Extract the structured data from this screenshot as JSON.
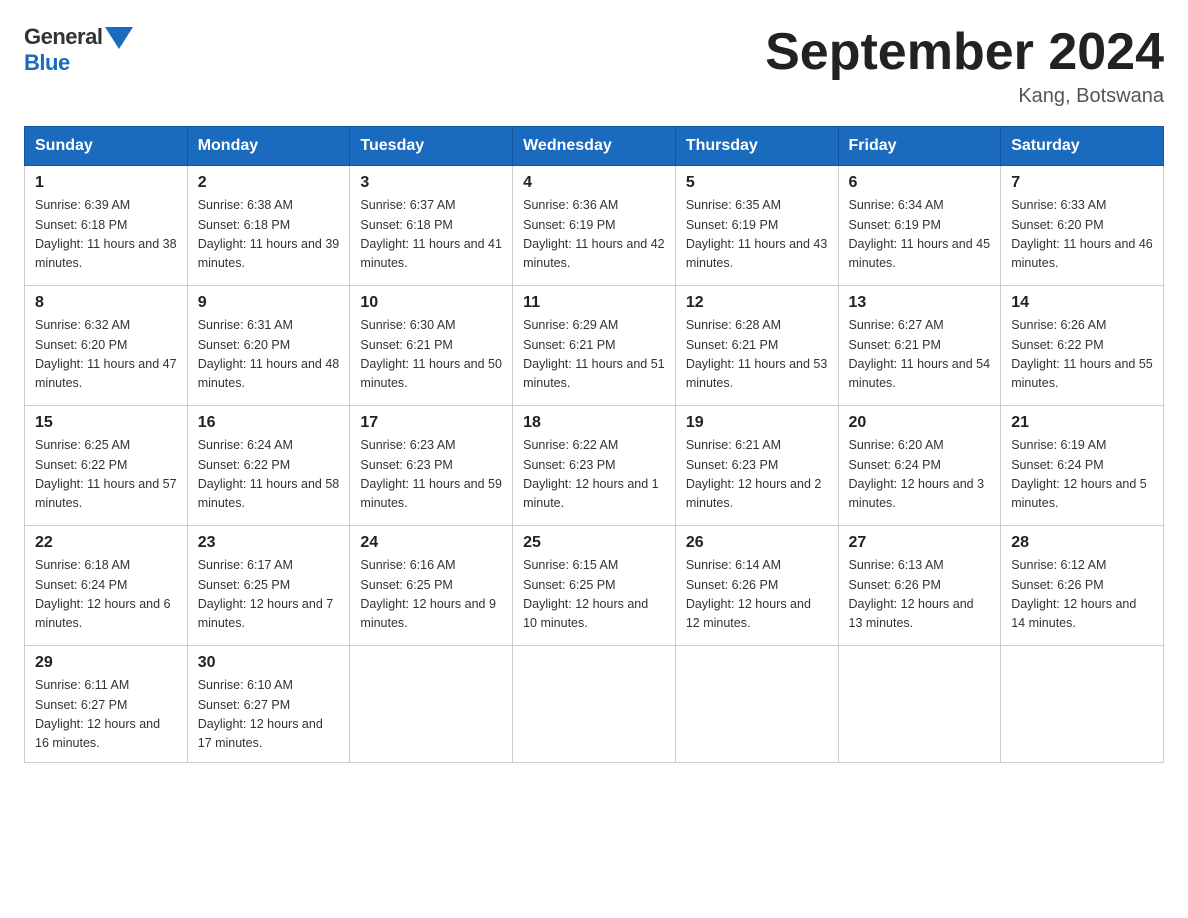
{
  "logo": {
    "general": "General",
    "blue": "Blue"
  },
  "title": "September 2024",
  "subtitle": "Kang, Botswana",
  "header_days": [
    "Sunday",
    "Monday",
    "Tuesday",
    "Wednesday",
    "Thursday",
    "Friday",
    "Saturday"
  ],
  "weeks": [
    [
      {
        "day": "1",
        "sunrise": "6:39 AM",
        "sunset": "6:18 PM",
        "daylight": "11 hours and 38 minutes."
      },
      {
        "day": "2",
        "sunrise": "6:38 AM",
        "sunset": "6:18 PM",
        "daylight": "11 hours and 39 minutes."
      },
      {
        "day": "3",
        "sunrise": "6:37 AM",
        "sunset": "6:18 PM",
        "daylight": "11 hours and 41 minutes."
      },
      {
        "day": "4",
        "sunrise": "6:36 AM",
        "sunset": "6:19 PM",
        "daylight": "11 hours and 42 minutes."
      },
      {
        "day": "5",
        "sunrise": "6:35 AM",
        "sunset": "6:19 PM",
        "daylight": "11 hours and 43 minutes."
      },
      {
        "day": "6",
        "sunrise": "6:34 AM",
        "sunset": "6:19 PM",
        "daylight": "11 hours and 45 minutes."
      },
      {
        "day": "7",
        "sunrise": "6:33 AM",
        "sunset": "6:20 PM",
        "daylight": "11 hours and 46 minutes."
      }
    ],
    [
      {
        "day": "8",
        "sunrise": "6:32 AM",
        "sunset": "6:20 PM",
        "daylight": "11 hours and 47 minutes."
      },
      {
        "day": "9",
        "sunrise": "6:31 AM",
        "sunset": "6:20 PM",
        "daylight": "11 hours and 48 minutes."
      },
      {
        "day": "10",
        "sunrise": "6:30 AM",
        "sunset": "6:21 PM",
        "daylight": "11 hours and 50 minutes."
      },
      {
        "day": "11",
        "sunrise": "6:29 AM",
        "sunset": "6:21 PM",
        "daylight": "11 hours and 51 minutes."
      },
      {
        "day": "12",
        "sunrise": "6:28 AM",
        "sunset": "6:21 PM",
        "daylight": "11 hours and 53 minutes."
      },
      {
        "day": "13",
        "sunrise": "6:27 AM",
        "sunset": "6:21 PM",
        "daylight": "11 hours and 54 minutes."
      },
      {
        "day": "14",
        "sunrise": "6:26 AM",
        "sunset": "6:22 PM",
        "daylight": "11 hours and 55 minutes."
      }
    ],
    [
      {
        "day": "15",
        "sunrise": "6:25 AM",
        "sunset": "6:22 PM",
        "daylight": "11 hours and 57 minutes."
      },
      {
        "day": "16",
        "sunrise": "6:24 AM",
        "sunset": "6:22 PM",
        "daylight": "11 hours and 58 minutes."
      },
      {
        "day": "17",
        "sunrise": "6:23 AM",
        "sunset": "6:23 PM",
        "daylight": "11 hours and 59 minutes."
      },
      {
        "day": "18",
        "sunrise": "6:22 AM",
        "sunset": "6:23 PM",
        "daylight": "12 hours and 1 minute."
      },
      {
        "day": "19",
        "sunrise": "6:21 AM",
        "sunset": "6:23 PM",
        "daylight": "12 hours and 2 minutes."
      },
      {
        "day": "20",
        "sunrise": "6:20 AM",
        "sunset": "6:24 PM",
        "daylight": "12 hours and 3 minutes."
      },
      {
        "day": "21",
        "sunrise": "6:19 AM",
        "sunset": "6:24 PM",
        "daylight": "12 hours and 5 minutes."
      }
    ],
    [
      {
        "day": "22",
        "sunrise": "6:18 AM",
        "sunset": "6:24 PM",
        "daylight": "12 hours and 6 minutes."
      },
      {
        "day": "23",
        "sunrise": "6:17 AM",
        "sunset": "6:25 PM",
        "daylight": "12 hours and 7 minutes."
      },
      {
        "day": "24",
        "sunrise": "6:16 AM",
        "sunset": "6:25 PM",
        "daylight": "12 hours and 9 minutes."
      },
      {
        "day": "25",
        "sunrise": "6:15 AM",
        "sunset": "6:25 PM",
        "daylight": "12 hours and 10 minutes."
      },
      {
        "day": "26",
        "sunrise": "6:14 AM",
        "sunset": "6:26 PM",
        "daylight": "12 hours and 12 minutes."
      },
      {
        "day": "27",
        "sunrise": "6:13 AM",
        "sunset": "6:26 PM",
        "daylight": "12 hours and 13 minutes."
      },
      {
        "day": "28",
        "sunrise": "6:12 AM",
        "sunset": "6:26 PM",
        "daylight": "12 hours and 14 minutes."
      }
    ],
    [
      {
        "day": "29",
        "sunrise": "6:11 AM",
        "sunset": "6:27 PM",
        "daylight": "12 hours and 16 minutes."
      },
      {
        "day": "30",
        "sunrise": "6:10 AM",
        "sunset": "6:27 PM",
        "daylight": "12 hours and 17 minutes."
      },
      null,
      null,
      null,
      null,
      null
    ]
  ],
  "labels": {
    "sunrise": "Sunrise:",
    "sunset": "Sunset:",
    "daylight": "Daylight:"
  }
}
